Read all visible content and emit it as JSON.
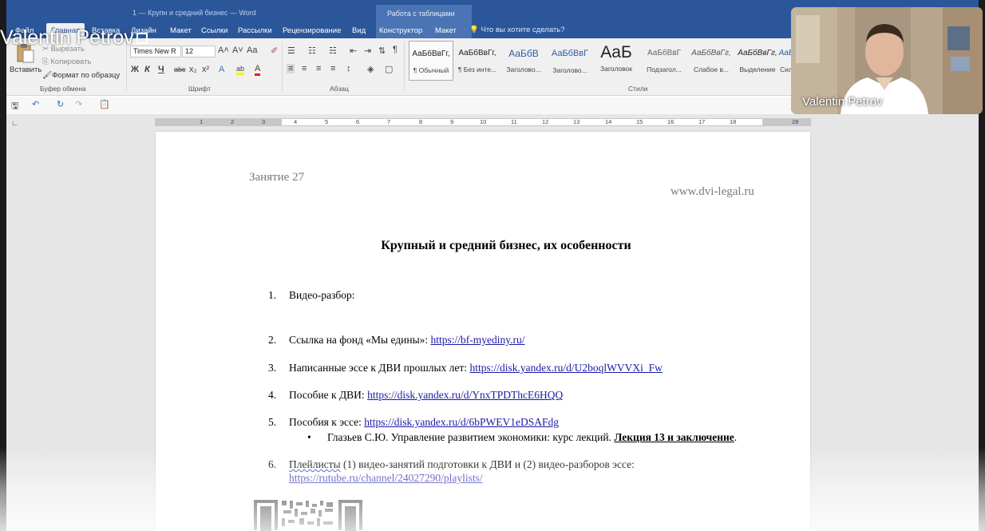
{
  "window": {
    "title": "1 — Крупн и средний бизнес — Word",
    "contextual_group": "Работа с таблицами",
    "tell_me": "Что вы хотите сделать?"
  },
  "tabs": [
    {
      "label": "Файл"
    },
    {
      "label": "Главная"
    },
    {
      "label": "Вставка"
    },
    {
      "label": "Дизайн"
    },
    {
      "label": "Макет"
    },
    {
      "label": "Ссылки"
    },
    {
      "label": "Рассылки"
    },
    {
      "label": "Рецензирование"
    },
    {
      "label": "Вид"
    },
    {
      "label": "Конструктор"
    },
    {
      "label": "Макет"
    }
  ],
  "ribbon": {
    "clipboard": {
      "paste": "Вставить",
      "cut": "Вырезать",
      "copy": "Копировать",
      "format_painter": "Формат по образцу",
      "group": "Буфер обмена"
    },
    "font": {
      "name": "Times New R",
      "size": "12",
      "group": "Шрифт",
      "bold": "Ж",
      "italic": "К",
      "underline": "Ч",
      "strike": "abc",
      "subscript": "x₂",
      "superscript": "x²",
      "grow": "A˄",
      "shrink": "A˅",
      "case": "Aa",
      "effects": "A",
      "highlight": "ab",
      "color": "A"
    },
    "paragraph": {
      "group": "Абзац",
      "pilcrow": "¶"
    },
    "styles": {
      "group": "Стили",
      "items": [
        {
          "sample": "АаБбВвГг,",
          "name": "¶ Обычный"
        },
        {
          "sample": "АаБбВвГг,",
          "name": "¶ Без инте..."
        },
        {
          "sample": "АаБбВ",
          "name": "Заголово..."
        },
        {
          "sample": "АаБбВвГ",
          "name": "Заголово..."
        },
        {
          "sample": "AaБ",
          "name": "Заголовок"
        },
        {
          "sample": "АаБбВвГ",
          "name": "Подзагол..."
        },
        {
          "sample": "АаБбВвГг,",
          "name": "Слабое в..."
        },
        {
          "sample": "АаБбВвГг,",
          "name": "Выделение"
        },
        {
          "sample": "АаБ",
          "name": "Сил"
        }
      ]
    }
  },
  "ruler": [
    "1",
    "2",
    "3",
    "4",
    "5",
    "6",
    "7",
    "8",
    "9",
    "10",
    "11",
    "12",
    "13",
    "14",
    "15",
    "16",
    "17",
    "18",
    "28"
  ],
  "document": {
    "header_left": "Занятие 27",
    "header_right": "www.dvi-legal.ru",
    "title": "Крупный и средний бизнес, их особенности",
    "items": [
      {
        "num": "1.",
        "text": "Видео-разбор:"
      },
      {
        "num": "2.",
        "text": "Ссылка на фонд «Мы едины»: ",
        "link": "https://bf-myediny.ru/"
      },
      {
        "num": "3.",
        "text": "Написанные эссе к ДВИ прошлых лет: ",
        "link": "https://disk.yandex.ru/d/U2boqlWVVXi_Fw"
      },
      {
        "num": "4.",
        "text": "Пособие к ДВИ: ",
        "link": "https://disk.yandex.ru/d/YnxTPDThcE6HQQ"
      },
      {
        "num": "5.",
        "text": "Пособия к эссе: ",
        "link": "https://disk.yandex.ru/d/6bPWEV1eDSAFdg"
      }
    ],
    "bullet": {
      "dot": "•",
      "text": "Глазьев С.Ю. Управление развитием экономики: курс лекций. ",
      "bold": "Лекция 13 и заключение",
      "end": "."
    },
    "item6": {
      "num": "6.",
      "word": "Плейлисты",
      "text": " (1) видео-занятий подготовки к ДВИ и (2) видео-разборов эссе:",
      "link": "https://rutube.ru/channel/24027290/playlists/"
    }
  },
  "overlay": {
    "presenter_name": "Valentin Petrov",
    "webcam_label": "Valentin Petrov"
  }
}
